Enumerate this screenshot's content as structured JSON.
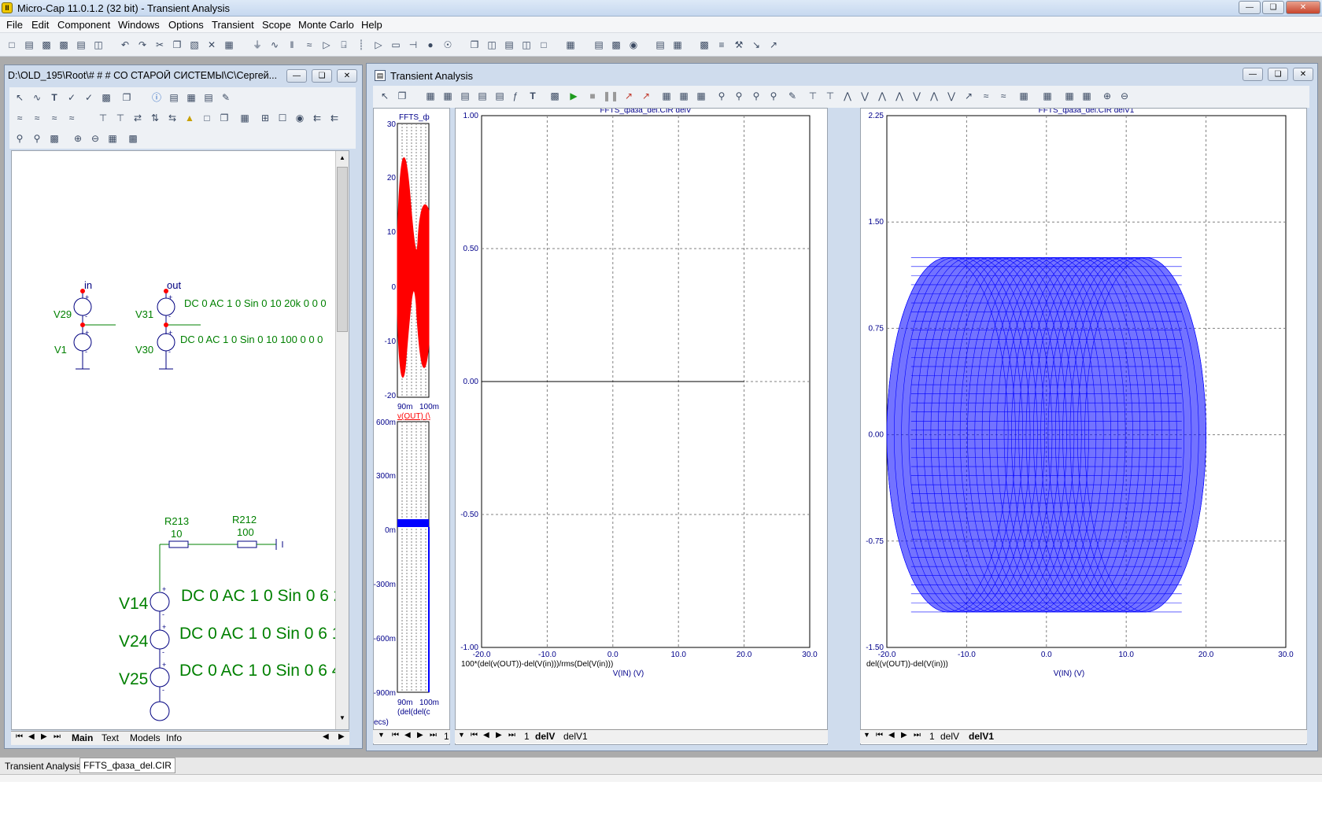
{
  "app": {
    "title": "Micro-Cap 11.0.1.2 (32 bit) - Transient Analysis",
    "icon": "microcap-icon"
  },
  "menu": [
    "File",
    "Edit",
    "Component",
    "Windows",
    "Options",
    "Transient",
    "Scope",
    "Monte Carlo",
    "Help"
  ],
  "schematic_window": {
    "title": "D:\\OLD_195\\Root\\# # # СО СТАРОЙ СИСТЕМЫ\\С\\Сергей...",
    "parts": {
      "node_in": "in",
      "node_out": "out",
      "v29": "V29",
      "v1": "V1",
      "v31": "V31",
      "v30": "V30",
      "v31_value": "DC 0 AC 1 0 Sin 0 10 20k 0 0 0",
      "v30_value": "DC 0 AC 1 0 Sin 0 10 100 0 0 0",
      "r213": "R213",
      "r213_value": "10",
      "r212": "R212",
      "r212_value": "100",
      "v14": "V14",
      "v14_value": "DC 0 AC 1 0 Sin 0 6 2",
      "v24": "V24",
      "v24_value": "DC 0 AC 1 0 Sin 0 6 1",
      "v25": "V25",
      "v25_value": "DC 0 AC 1 0 Sin 0 6 4"
    },
    "tabs": [
      "Main",
      "Text",
      "Models",
      "Info"
    ],
    "active_tab": "Main"
  },
  "transient_window": {
    "title": "Transient Analysis",
    "left_strip": {
      "top_title": "FFTS_ф",
      "top_y_ticks": [
        "30",
        "20",
        "10",
        "0",
        "-10",
        "-20"
      ],
      "top_x_ticks": [
        "90m",
        "100m"
      ],
      "top_trace_label": "v(OUT) (\\",
      "bottom_y_ticks": [
        "600m",
        "300m",
        "0m",
        "-300m",
        "-600m",
        "-900m"
      ],
      "bottom_x_ticks": [
        "90m",
        "100m"
      ],
      "bottom_trace_label": "(del(del(c",
      "units_label": "ecs)"
    },
    "tabs_left": [
      "1"
    ],
    "tabs_mid": [
      "1",
      "delV",
      "delV1"
    ],
    "active_mid": "delV",
    "tabs_right": [
      "1",
      "delV",
      "delV1"
    ],
    "active_right": "delV1"
  },
  "chart_data": [
    {
      "type": "line",
      "title": "FFTS_фаза_del.CIR delV",
      "xlabel": "V(IN) (V)",
      "ylabel": "100*(del(v(OUT))-del(V(in)))/rms(Del(V(in)))",
      "xlim": [
        -20,
        30
      ],
      "ylim": [
        -1,
        1
      ],
      "x_ticks": [
        "-20.0",
        "-10.0",
        "0.0",
        "10.0",
        "20.0",
        "30.0"
      ],
      "y_ticks": [
        "1.00",
        "0.50",
        "0.00",
        "-0.50",
        "-1.00"
      ],
      "series": [
        {
          "x": [
            -20,
            20
          ],
          "y": [
            0,
            0
          ],
          "color": "#000000"
        }
      ],
      "grid": true
    },
    {
      "type": "line",
      "title": "FFTS_фаза_del.CIR delV1",
      "xlabel": "V(IN) (V)",
      "ylabel": "del((v(OUT))-del(V(in)))",
      "xlim": [
        -20,
        30
      ],
      "ylim": [
        -1.5,
        2.25
      ],
      "x_ticks": [
        "-20.0",
        "-10.0",
        "0.0",
        "10.0",
        "20.0",
        "30.0"
      ],
      "y_ticks": [
        "2.25",
        "1.50",
        "0.75",
        "0.00",
        "-0.75",
        "-1.50"
      ],
      "series": [
        {
          "envelope_x": [
            -20,
            20
          ],
          "envelope_y": [
            -1.25,
            1.25
          ],
          "color": "#0000ff"
        }
      ],
      "grid": true
    }
  ],
  "bottom_tabs": [
    "Transient Analysis",
    "FFTS_фаза_del.CIR"
  ],
  "colors": {
    "trace_blue": "#0000ff",
    "trace_red": "#ff0000",
    "schematic_green": "#008000",
    "axis_blue": "#00008b"
  }
}
